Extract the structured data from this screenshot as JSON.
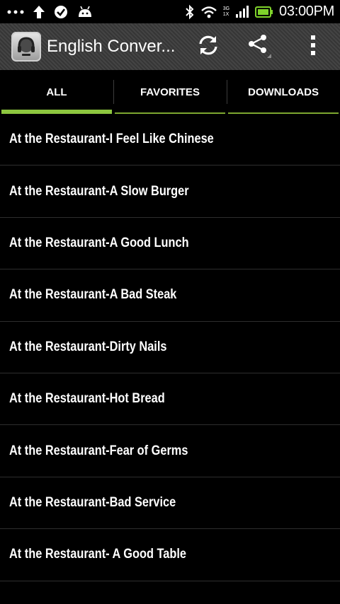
{
  "status_bar": {
    "time": "03:00PM",
    "network_top": "3G",
    "network_bottom": "1X",
    "icons": [
      "more-dots-icon",
      "upload-arrow-icon",
      "check-circle-icon",
      "android-icon",
      "bluetooth-icon",
      "wifi-icon",
      "signal-icon",
      "battery-icon"
    ]
  },
  "action_bar": {
    "title": "English Conver...",
    "icons": [
      "app-logo-icon",
      "refresh-icon",
      "share-icon",
      "overflow-menu-icon"
    ]
  },
  "tabs": [
    {
      "label": "ALL",
      "active": true
    },
    {
      "label": "FAVORITES",
      "active": false
    },
    {
      "label": "DOWNLOADS",
      "active": false
    }
  ],
  "colors": {
    "accent": "#8dc63f",
    "background": "#000000",
    "action_bar": "#3a3a3a",
    "divider": "#2e2e2e"
  },
  "list": {
    "items": [
      "At the Restaurant-I Feel Like Chinese",
      "At the Restaurant-A Slow Burger",
      "At the Restaurant-A Good Lunch",
      "At the Restaurant-A Bad Steak",
      "At the Restaurant-Dirty Nails",
      "At the Restaurant-Hot Bread",
      "At the Restaurant-Fear of Germs",
      "At the Restaurant-Bad Service",
      "At the Restaurant- A Good Table"
    ]
  }
}
